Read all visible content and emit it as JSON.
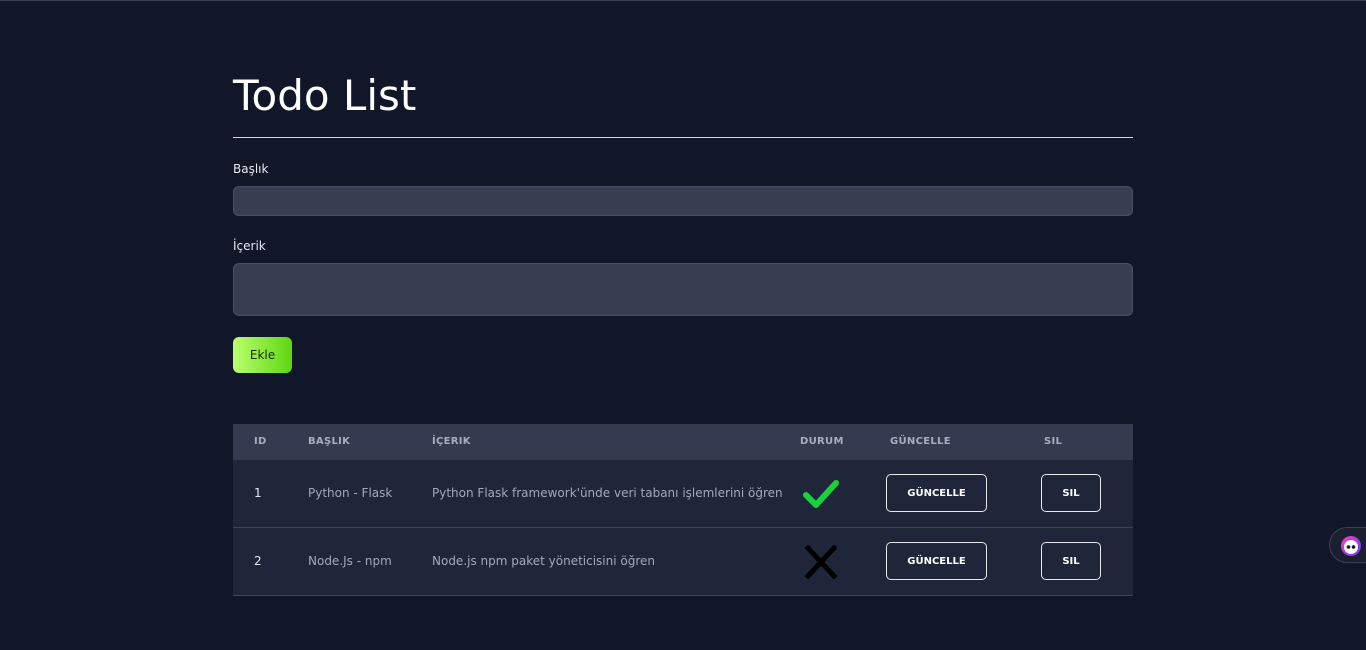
{
  "page": {
    "title": "Todo List"
  },
  "form": {
    "title_label": "Başlık",
    "title_value": "",
    "content_label": "İçerik",
    "content_value": "",
    "add_button_label": "Ekle"
  },
  "table": {
    "headers": [
      "ID",
      "BAŞLIK",
      "İÇERIK",
      "DURUM",
      "GÜNCELLE",
      "SIL"
    ],
    "rows": [
      {
        "id": "1",
        "title": "Python - Flask",
        "content": "Python Flask framework'ünde veri tabanı işlemlerini öğren",
        "status": "complete",
        "status_icon": "check-icon",
        "update_label": "GÜNCELLE",
        "delete_label": "SIL"
      },
      {
        "id": "2",
        "title": "Node.Js - npm",
        "content": "Node.js npm paket yöneticisini öğren",
        "status": "incomplete",
        "status_icon": "cross-icon",
        "update_label": "GÜNCELLE",
        "delete_label": "SIL"
      }
    ]
  },
  "colors": {
    "background": "#121629",
    "accent_green_start": "#b8ff6e",
    "accent_green_end": "#5fd60f",
    "check_green": "#19d13c",
    "cross_black": "#000000"
  },
  "widget": {
    "icon": "assistant-face-icon"
  }
}
